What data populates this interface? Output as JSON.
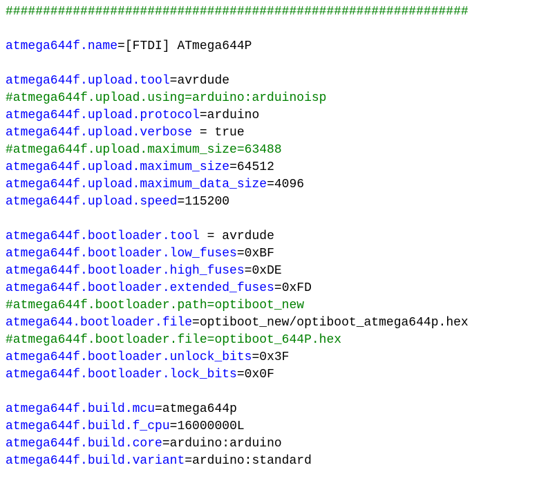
{
  "colors": {
    "key": "#0000ff",
    "operator": "#000000",
    "value": "#000000",
    "comment": "#008000",
    "background": "#ffffff"
  },
  "lines": [
    {
      "type": "comment",
      "text": "##############################################################"
    },
    {
      "type": "blank"
    },
    {
      "type": "prop",
      "key": "atmega644f.name",
      "op": "=",
      "value": "[FTDI] ATmega644P"
    },
    {
      "type": "blank"
    },
    {
      "type": "prop",
      "key": "atmega644f.upload.tool",
      "op": "=",
      "value": "avrdude"
    },
    {
      "type": "comment",
      "text": "#atmega644f.upload.using=arduino:arduinoisp"
    },
    {
      "type": "prop",
      "key": "atmega644f.upload.protocol",
      "op": "=",
      "value": "arduino"
    },
    {
      "type": "prop",
      "key": "atmega644f.upload.verbose",
      "op": " = ",
      "value": "true"
    },
    {
      "type": "comment",
      "text": "#atmega644f.upload.maximum_size=63488"
    },
    {
      "type": "prop",
      "key": "atmega644f.upload.maximum_size",
      "op": "=",
      "value": "64512"
    },
    {
      "type": "prop",
      "key": "atmega644f.upload.maximum_data_size",
      "op": "=",
      "value": "4096"
    },
    {
      "type": "prop",
      "key": "atmega644f.upload.speed",
      "op": "=",
      "value": "115200"
    },
    {
      "type": "blank"
    },
    {
      "type": "prop",
      "key": "atmega644f.bootloader.tool",
      "op": " = ",
      "value": "avrdude"
    },
    {
      "type": "prop",
      "key": "atmega644f.bootloader.low_fuses",
      "op": "=",
      "value": "0xBF"
    },
    {
      "type": "prop",
      "key": "atmega644f.bootloader.high_fuses",
      "op": "=",
      "value": "0xDE"
    },
    {
      "type": "prop",
      "key": "atmega644f.bootloader.extended_fuses",
      "op": "=",
      "value": "0xFD"
    },
    {
      "type": "comment",
      "text": "#atmega644f.bootloader.path=optiboot_new"
    },
    {
      "type": "prop",
      "key": "atmega644.bootloader.file",
      "op": "=",
      "value": "optiboot_new/optiboot_atmega644p.hex"
    },
    {
      "type": "comment",
      "text": "#atmega644f.bootloader.file=optiboot_644P.hex"
    },
    {
      "type": "prop",
      "key": "atmega644f.bootloader.unlock_bits",
      "op": "=",
      "value": "0x3F"
    },
    {
      "type": "prop",
      "key": "atmega644f.bootloader.lock_bits",
      "op": "=",
      "value": "0x0F"
    },
    {
      "type": "blank"
    },
    {
      "type": "prop",
      "key": "atmega644f.build.mcu",
      "op": "=",
      "value": "atmega644p"
    },
    {
      "type": "prop",
      "key": "atmega644f.build.f_cpu",
      "op": "=",
      "value": "16000000L"
    },
    {
      "type": "prop",
      "key": "atmega644f.build.core",
      "op": "=",
      "value": "arduino:arduino"
    },
    {
      "type": "prop",
      "key": "atmega644f.build.variant",
      "op": "=",
      "value": "arduino:standard"
    }
  ]
}
